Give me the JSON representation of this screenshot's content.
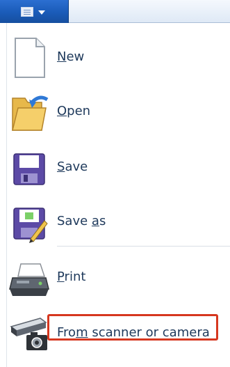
{
  "menu": {
    "items": [
      {
        "pre": "",
        "u": "N",
        "post": "ew",
        "icon": "new-document-icon"
      },
      {
        "pre": "",
        "u": "O",
        "post": "pen",
        "icon": "open-folder-icon"
      },
      {
        "pre": "",
        "u": "S",
        "post": "ave",
        "icon": "save-disk-icon"
      },
      {
        "pre": "Save ",
        "u": "a",
        "post": "s",
        "icon": "save-as-icon"
      },
      {
        "pre": "",
        "u": "P",
        "post": "rint",
        "icon": "printer-icon"
      },
      {
        "pre": "Fro",
        "u": "m",
        "post": " scanner or camera",
        "icon": "scanner-camera-icon"
      }
    ]
  },
  "colors": {
    "app_button": "#1a5bb8",
    "label_text": "#1e395b",
    "highlight_border": "#d6371f"
  }
}
